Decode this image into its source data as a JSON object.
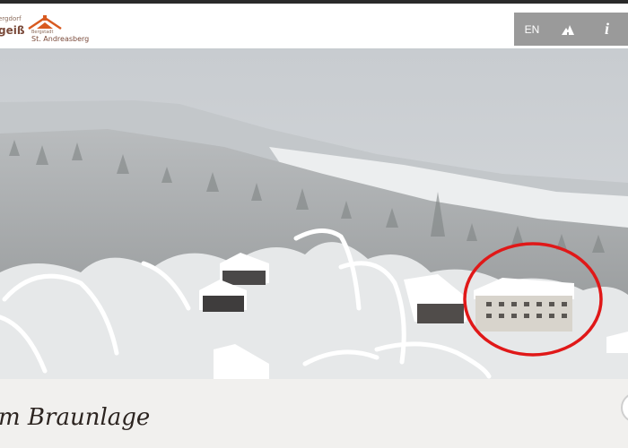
{
  "header": {
    "logo_left_line1": "ergdorf",
    "logo_left_line2": "geiß",
    "logo_right_line1": "Bergstadt",
    "logo_right_line2": "St. Andreasberg",
    "lang_label": "EN",
    "map_icon": "mountain-icon",
    "info_label": "i"
  },
  "footer": {
    "location_title": "m Braunlage"
  },
  "colors": {
    "button_bg": "#9a9a9a",
    "highlight_circle": "#e01818",
    "logo_accent": "#d85a20"
  }
}
